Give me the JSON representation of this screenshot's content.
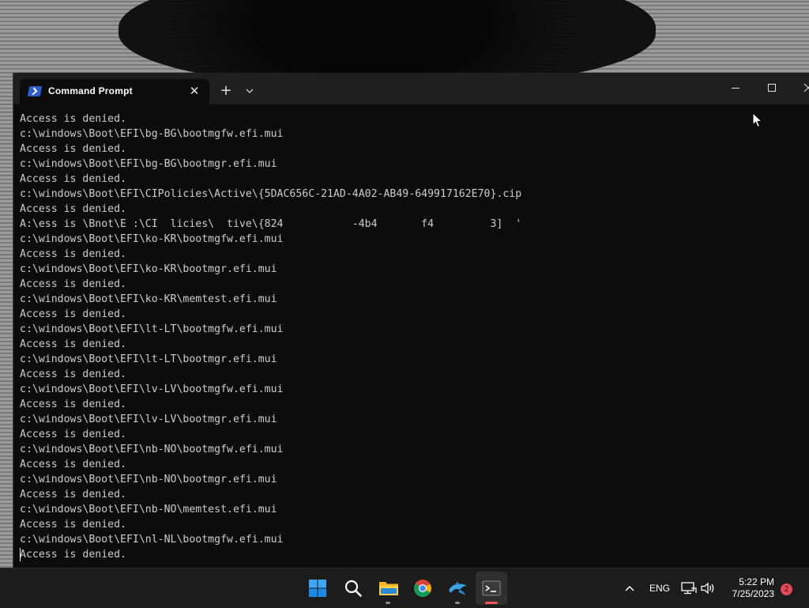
{
  "window": {
    "tab_title": "Command Prompt",
    "tab_close_glyph": "✕",
    "new_tab_glyph": "+",
    "tab_icon": "terminal-icon"
  },
  "console": {
    "lines": [
      "Access is denied.",
      "c:\\windows\\Boot\\EFI\\bg-BG\\bootmgfw.efi.mui",
      "Access is denied.",
      "c:\\windows\\Boot\\EFI\\bg-BG\\bootmgr.efi.mui",
      "Access is denied.",
      "c:\\windows\\Boot\\EFI\\CIPolicies\\Active\\{5DAC656C-21AD-4A02-AB49-649917162E70}.cip",
      "Access is denied.",
      "A:\\ess is \\Bnot\\E :\\CI  licies\\  tive\\{824           -4b4       f4         3]  '",
      "c:\\windows\\Boot\\EFI\\ko-KR\\bootmgfw.efi.mui",
      "Access is denied.",
      "c:\\windows\\Boot\\EFI\\ko-KR\\bootmgr.efi.mui",
      "Access is denied.",
      "c:\\windows\\Boot\\EFI\\ko-KR\\memtest.efi.mui",
      "Access is denied.",
      "c:\\windows\\Boot\\EFI\\lt-LT\\bootmgfw.efi.mui",
      "Access is denied.",
      "c:\\windows\\Boot\\EFI\\lt-LT\\bootmgr.efi.mui",
      "Access is denied.",
      "c:\\windows\\Boot\\EFI\\lv-LV\\bootmgfw.efi.mui",
      "Access is denied.",
      "c:\\windows\\Boot\\EFI\\lv-LV\\bootmgr.efi.mui",
      "Access is denied.",
      "c:\\windows\\Boot\\EFI\\nb-NO\\bootmgfw.efi.mui",
      "Access is denied.",
      "c:\\windows\\Boot\\EFI\\nb-NO\\bootmgr.efi.mui",
      "Access is denied.",
      "c:\\windows\\Boot\\EFI\\nb-NO\\memtest.efi.mui",
      "Access is denied.",
      "c:\\windows\\Boot\\EFI\\nl-NL\\bootmgfw.efi.mui",
      "Access is denied."
    ]
  },
  "taskbar": {
    "apps": [
      {
        "name": "start-icon",
        "active": false
      },
      {
        "name": "search-icon",
        "active": false
      },
      {
        "name": "file-explorer-icon",
        "active": false
      },
      {
        "name": "chrome-icon",
        "active": false
      },
      {
        "name": "dolphin-emulator-icon",
        "active": false
      },
      {
        "name": "terminal-icon",
        "active": true
      }
    ],
    "tray": {
      "language": "ENG",
      "time": "5:22 PM",
      "date": "7/25/2023",
      "notification_count": "2"
    }
  },
  "colors": {
    "console_bg": "#0c0c0c",
    "console_text": "#cccccc",
    "titlebar_bg": "#1f1f1f",
    "taskbar_bg": "#1c1c1c",
    "badge": "#e74856",
    "active_indicator": "#f05656"
  }
}
